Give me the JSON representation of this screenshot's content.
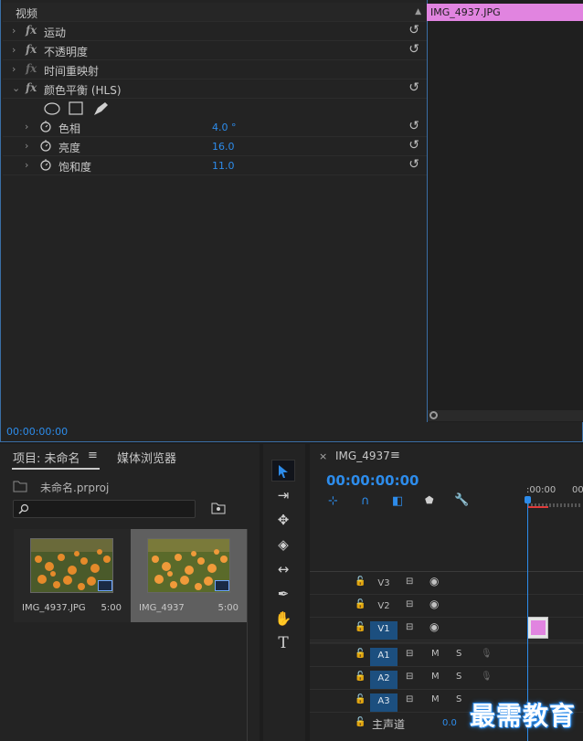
{
  "effect_controls": {
    "header": "视频",
    "clip_name": "IMG_4937.JPG",
    "timecode": "00:00:00:00",
    "effects": [
      {
        "label": "运动",
        "fx": "fx"
      },
      {
        "label": "不透明度",
        "fx": "fx"
      },
      {
        "label": "时间重映射",
        "fx": "fx"
      },
      {
        "label": "颜色平衡 (HLS)",
        "fx": "fx"
      }
    ],
    "params": [
      {
        "label": "色相",
        "value": "4.0 °"
      },
      {
        "label": "亮度",
        "value": "16.0"
      },
      {
        "label": "饱和度",
        "value": "11.0"
      }
    ]
  },
  "project": {
    "tab_label": "项目: 未命名",
    "menu_icon": "≡",
    "media_browser_tab": "媒体浏览器",
    "file_name": "未命名.prproj",
    "items": [
      {
        "name": "IMG_4937.JPG",
        "duration": "5:00"
      },
      {
        "name": "IMG_4937",
        "duration": "5:00"
      }
    ]
  },
  "sequence": {
    "close": "×",
    "tab_label": "IMG_4937",
    "menu_icon": "≡",
    "timecode": "00:00:00:00",
    "ruler_labels": [
      ":00:00",
      "00"
    ],
    "tracks": [
      {
        "name": "V3",
        "type": "video"
      },
      {
        "name": "V2",
        "type": "video"
      },
      {
        "name": "V1",
        "type": "video"
      },
      {
        "name": "A1",
        "type": "audio"
      },
      {
        "name": "A2",
        "type": "audio"
      },
      {
        "name": "A3",
        "type": "audio"
      }
    ],
    "master": {
      "label": "主声道",
      "value": "0.0"
    },
    "mute": "M",
    "solo": "S"
  },
  "watermark": "最需教育",
  "colors": {
    "accent": "#2d8ceb",
    "clip": "#e184e0"
  }
}
